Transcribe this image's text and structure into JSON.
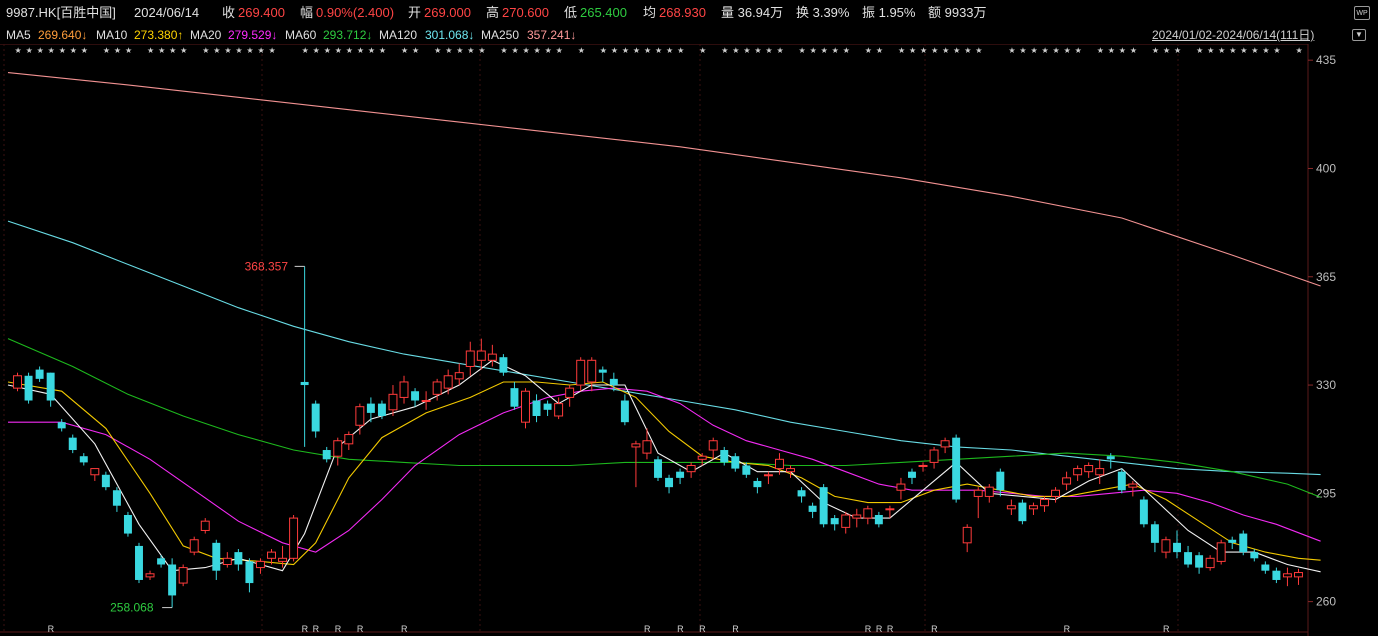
{
  "header": {
    "code": "9987.HK[百胜中国]",
    "date": "2024/06/14",
    "close_label": "收",
    "close_value": "269.400",
    "change_label": "幅",
    "change_value": "0.90%(2.400)",
    "open_label": "开",
    "open_value": "269.000",
    "high_label": "高",
    "high_value": "270.600",
    "low_label": "低",
    "low_value": "265.400",
    "avg_label": "均",
    "avg_value": "268.930",
    "volume": "量 36.94万",
    "turnover": "换 3.39%",
    "amplitude": "振 1.95%",
    "amount": "额 9933万",
    "wp_icon": "WP"
  },
  "ma_bar": {
    "ma5_label": "MA5",
    "ma5_value": "269.640↓",
    "ma10_label": "MA10",
    "ma10_value": "273.380↑",
    "ma20_label": "MA20",
    "ma20_value": "279.529↓",
    "ma60_label": "MA60",
    "ma60_value": "293.712↓",
    "ma120_label": "MA120",
    "ma120_value": "301.068↓",
    "ma250_label": "MA250",
    "ma250_value": "357.241↓",
    "range": "2024/01/02-2024/06/14(111日)",
    "dropdown_icon": "chevron-down-icon"
  },
  "colors": {
    "up": "#ff3b3b",
    "down": "#3ad8e0",
    "ma5": "#ffffff",
    "ma10": "#ffd400",
    "ma20": "#ff2cff",
    "ma60": "#1fc21f",
    "ma120": "#6ee7f0",
    "ma250": "#ff9a9a",
    "grid": "#3a1010",
    "axis_text": "#bdbdbd"
  },
  "chart_data": {
    "type": "candlestick",
    "ylim": [
      256,
      437
    ],
    "y_ticks": [
      435,
      400,
      365,
      330,
      295,
      260
    ],
    "annotations": {
      "max_label": "368.357",
      "min_label": "258.068"
    },
    "candles": [
      [
        329,
        333,
        328,
        334
      ],
      [
        333,
        325,
        324,
        334
      ],
      [
        335,
        332,
        331,
        336
      ],
      [
        334,
        325,
        323,
        334
      ],
      [
        318,
        316,
        315,
        319
      ],
      [
        313,
        309,
        308,
        314
      ],
      [
        307,
        305,
        304,
        308
      ],
      [
        301,
        303,
        299,
        303
      ],
      [
        301,
        297,
        296,
        302
      ],
      [
        296,
        291,
        289,
        297
      ],
      [
        288,
        282,
        281,
        289
      ],
      [
        278,
        267,
        266,
        279
      ],
      [
        268,
        269,
        267,
        270
      ],
      [
        274,
        272,
        271,
        275
      ],
      [
        272,
        262,
        258.068,
        274
      ],
      [
        266,
        271,
        265,
        272
      ],
      [
        276,
        280,
        275,
        281
      ],
      [
        283,
        286,
        282,
        287
      ],
      [
        279,
        270,
        267,
        280
      ],
      [
        272,
        274,
        271,
        276
      ],
      [
        276,
        272,
        270,
        277
      ],
      [
        273,
        266,
        263,
        274
      ],
      [
        271,
        273,
        269,
        274
      ],
      [
        274,
        276,
        272,
        277
      ],
      [
        273,
        274,
        271,
        278
      ],
      [
        274,
        287,
        273,
        288
      ],
      [
        331,
        330,
        310,
        368.357
      ],
      [
        324,
        315,
        313,
        325
      ],
      [
        309,
        306,
        305,
        310
      ],
      [
        307,
        312,
        304,
        313
      ],
      [
        311,
        314,
        309,
        315
      ],
      [
        317,
        323,
        314,
        324
      ],
      [
        324,
        321,
        318,
        326
      ],
      [
        324,
        320,
        319,
        325
      ],
      [
        322,
        327,
        320,
        330
      ],
      [
        326,
        331,
        324,
        333
      ],
      [
        328,
        325,
        323,
        329
      ],
      [
        325,
        325,
        322,
        328
      ],
      [
        327,
        331,
        325,
        332
      ],
      [
        329,
        333,
        327,
        335
      ],
      [
        332,
        334,
        330,
        337
      ],
      [
        336,
        341,
        333,
        344
      ],
      [
        338,
        341,
        335,
        345
      ],
      [
        338,
        340,
        336,
        343
      ],
      [
        339,
        334,
        333,
        340
      ],
      [
        329,
        323,
        322,
        331
      ],
      [
        318,
        328,
        316,
        329
      ],
      [
        325,
        320,
        318,
        327
      ],
      [
        324,
        322,
        320,
        325
      ],
      [
        320,
        324,
        319,
        326
      ],
      [
        326,
        329,
        323,
        330
      ],
      [
        330,
        338,
        328,
        339
      ],
      [
        331,
        338,
        328,
        339
      ],
      [
        335,
        334,
        331,
        336
      ],
      [
        332,
        330,
        328,
        334
      ],
      [
        325,
        318,
        317,
        327
      ],
      [
        310,
        311,
        297,
        312
      ],
      [
        308,
        312,
        306,
        316
      ],
      [
        306,
        300,
        299,
        307
      ],
      [
        300,
        297,
        295,
        301
      ],
      [
        302,
        300,
        298,
        303
      ],
      [
        302,
        304,
        300,
        305
      ],
      [
        306,
        307,
        304,
        308
      ],
      [
        309,
        312,
        306,
        313
      ],
      [
        309,
        305,
        304,
        310
      ],
      [
        307,
        303,
        302,
        308
      ],
      [
        304,
        301,
        300,
        305
      ],
      [
        299,
        297,
        295,
        300
      ],
      [
        301,
        301,
        298,
        302
      ],
      [
        303,
        306,
        301,
        308
      ],
      [
        302,
        303,
        300,
        304
      ],
      [
        296,
        294,
        292,
        297
      ],
      [
        291,
        289,
        287,
        292
      ],
      [
        297,
        285,
        284,
        298
      ],
      [
        287,
        285,
        283,
        288
      ],
      [
        284,
        288,
        282,
        289
      ],
      [
        287,
        288,
        284,
        290
      ],
      [
        287,
        290,
        285,
        291
      ],
      [
        288,
        285,
        284,
        289
      ],
      [
        290,
        290,
        287,
        291
      ],
      [
        296,
        298,
        293,
        300
      ],
      [
        302,
        300,
        298,
        303
      ],
      [
        304,
        304,
        302,
        305
      ],
      [
        305,
        309,
        303,
        310
      ],
      [
        310,
        312,
        308,
        313
      ],
      [
        313,
        293,
        292,
        314
      ],
      [
        279,
        284,
        276,
        285
      ],
      [
        294,
        296,
        287,
        297
      ],
      [
        294,
        297,
        292,
        298
      ],
      [
        302,
        296,
        294,
        303
      ],
      [
        290,
        291,
        288,
        293
      ],
      [
        292,
        286,
        285,
        293
      ],
      [
        290,
        291,
        288,
        292
      ],
      [
        291,
        293,
        289,
        294
      ],
      [
        294,
        296,
        292,
        297
      ],
      [
        298,
        300,
        296,
        302
      ],
      [
        301,
        303,
        299,
        304
      ],
      [
        302,
        304,
        300,
        305
      ],
      [
        301,
        303,
        298,
        306
      ],
      [
        307,
        306,
        303,
        308
      ],
      [
        302,
        296,
        295,
        303
      ],
      [
        297,
        298,
        294,
        299
      ],
      [
        293,
        285,
        284,
        294
      ],
      [
        285,
        279,
        276,
        286
      ],
      [
        276,
        280,
        274,
        281
      ],
      [
        279,
        276,
        274,
        283
      ],
      [
        276,
        272,
        271,
        278
      ],
      [
        275,
        271,
        269,
        276
      ],
      [
        271,
        274,
        270,
        275
      ],
      [
        273,
        279,
        272,
        280
      ],
      [
        280,
        279,
        277,
        281
      ],
      [
        282,
        276,
        275,
        283
      ],
      [
        276,
        274,
        273,
        277
      ],
      [
        272,
        270,
        269,
        273
      ],
      [
        270,
        267,
        266,
        271
      ],
      [
        268,
        269,
        265,
        271
      ],
      [
        268,
        269.4,
        265.4,
        270.6
      ]
    ],
    "ma_series": {
      "ma5": [
        [
          0,
          330
        ],
        [
          3,
          327
        ],
        [
          7,
          311
        ],
        [
          11,
          285
        ],
        [
          14,
          270
        ],
        [
          17,
          271
        ],
        [
          20,
          274
        ],
        [
          24,
          270
        ],
        [
          26,
          282
        ],
        [
          29,
          310
        ],
        [
          32,
          319
        ],
        [
          36,
          323
        ],
        [
          40,
          330
        ],
        [
          43,
          338
        ],
        [
          46,
          333
        ],
        [
          49,
          324
        ],
        [
          52,
          330
        ],
        [
          55,
          330
        ],
        [
          58,
          308
        ],
        [
          61,
          302
        ],
        [
          64,
          308
        ],
        [
          67,
          302
        ],
        [
          70,
          302
        ],
        [
          73,
          292
        ],
        [
          76,
          287
        ],
        [
          79,
          287
        ],
        [
          82,
          296
        ],
        [
          85,
          305
        ],
        [
          88,
          295
        ],
        [
          91,
          294
        ],
        [
          94,
          293
        ],
        [
          97,
          299
        ],
        [
          100,
          303
        ],
        [
          103,
          293
        ],
        [
          106,
          283
        ],
        [
          109,
          276
        ],
        [
          112,
          276
        ],
        [
          115,
          272
        ],
        [
          118,
          269.64
        ]
      ],
      "ma10": [
        [
          0,
          331
        ],
        [
          4,
          328
        ],
        [
          8,
          316
        ],
        [
          12,
          295
        ],
        [
          15,
          278
        ],
        [
          18,
          274
        ],
        [
          22,
          273
        ],
        [
          25,
          272
        ],
        [
          27,
          279
        ],
        [
          30,
          300
        ],
        [
          33,
          313
        ],
        [
          37,
          321
        ],
        [
          41,
          326
        ],
        [
          44,
          331
        ],
        [
          47,
          331
        ],
        [
          50,
          330
        ],
        [
          53,
          331
        ],
        [
          56,
          326
        ],
        [
          59,
          315
        ],
        [
          62,
          307
        ],
        [
          65,
          305
        ],
        [
          68,
          304
        ],
        [
          71,
          300
        ],
        [
          74,
          294
        ],
        [
          77,
          292
        ],
        [
          80,
          292
        ],
        [
          83,
          296
        ],
        [
          86,
          298
        ],
        [
          89,
          296
        ],
        [
          92,
          294
        ],
        [
          95,
          294
        ],
        [
          98,
          296
        ],
        [
          101,
          298
        ],
        [
          104,
          293
        ],
        [
          107,
          286
        ],
        [
          110,
          279
        ],
        [
          113,
          276
        ],
        [
          116,
          274
        ],
        [
          118,
          273.38
        ]
      ],
      "ma20": [
        [
          0,
          318
        ],
        [
          4,
          318
        ],
        [
          8,
          314
        ],
        [
          12,
          306
        ],
        [
          16,
          296
        ],
        [
          20,
          286
        ],
        [
          24,
          279
        ],
        [
          27,
          276
        ],
        [
          30,
          283
        ],
        [
          33,
          293
        ],
        [
          36,
          304
        ],
        [
          40,
          314
        ],
        [
          44,
          321
        ],
        [
          48,
          326
        ],
        [
          51,
          328
        ],
        [
          54,
          329
        ],
        [
          57,
          328
        ],
        [
          60,
          324
        ],
        [
          63,
          317
        ],
        [
          66,
          312
        ],
        [
          69,
          309
        ],
        [
          72,
          306
        ],
        [
          75,
          302
        ],
        [
          78,
          298
        ],
        [
          81,
          296
        ],
        [
          84,
          296
        ],
        [
          87,
          296
        ],
        [
          90,
          295
        ],
        [
          93,
          294
        ],
        [
          96,
          294
        ],
        [
          99,
          295
        ],
        [
          102,
          296
        ],
        [
          105,
          295
        ],
        [
          108,
          292
        ],
        [
          111,
          288
        ],
        [
          114,
          285
        ],
        [
          118,
          279.53
        ]
      ],
      "ma60": [
        [
          0,
          345
        ],
        [
          5,
          336
        ],
        [
          10,
          327
        ],
        [
          15,
          320
        ],
        [
          20,
          314
        ],
        [
          25,
          309
        ],
        [
          30,
          306
        ],
        [
          35,
          305
        ],
        [
          40,
          304
        ],
        [
          45,
          304
        ],
        [
          50,
          304
        ],
        [
          55,
          305
        ],
        [
          60,
          305
        ],
        [
          65,
          305
        ],
        [
          70,
          304
        ],
        [
          75,
          304
        ],
        [
          80,
          305
        ],
        [
          85,
          306
        ],
        [
          90,
          307
        ],
        [
          95,
          308
        ],
        [
          100,
          307
        ],
        [
          105,
          305
        ],
        [
          110,
          302
        ],
        [
          115,
          298
        ],
        [
          118,
          293.71
        ]
      ],
      "ma120": [
        [
          0,
          383
        ],
        [
          5,
          376
        ],
        [
          10,
          369
        ],
        [
          15,
          362
        ],
        [
          20,
          355
        ],
        [
          25,
          349
        ],
        [
          30,
          344
        ],
        [
          35,
          340
        ],
        [
          40,
          337
        ],
        [
          45,
          334
        ],
        [
          50,
          331
        ],
        [
          55,
          328
        ],
        [
          60,
          325
        ],
        [
          65,
          322
        ],
        [
          70,
          318
        ],
        [
          75,
          315
        ],
        [
          80,
          312
        ],
        [
          85,
          310
        ],
        [
          90,
          309
        ],
        [
          95,
          307
        ],
        [
          100,
          305
        ],
        [
          105,
          303
        ],
        [
          110,
          302
        ],
        [
          115,
          301.5
        ],
        [
          118,
          301.07
        ]
      ],
      "ma250": [
        [
          0,
          431
        ],
        [
          10,
          427
        ],
        [
          20,
          423
        ],
        [
          30,
          419
        ],
        [
          40,
          415
        ],
        [
          50,
          411
        ],
        [
          60,
          407
        ],
        [
          70,
          402
        ],
        [
          80,
          397
        ],
        [
          90,
          391
        ],
        [
          100,
          384
        ],
        [
          110,
          372
        ],
        [
          118,
          362
        ]
      ]
    },
    "bottom_markers": "R",
    "top_markers": "★"
  }
}
